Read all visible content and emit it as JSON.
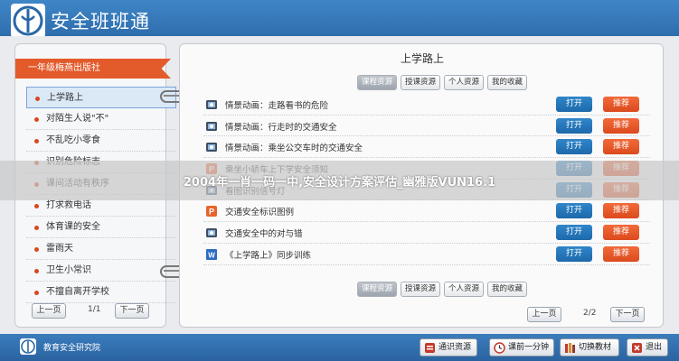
{
  "app": {
    "title": "安全班班通",
    "footer_org": "教育安全研究院"
  },
  "left_panel": {
    "grade_banner": "一年级梅燕出版社",
    "lessons": [
      {
        "label": "上学路上",
        "active": true
      },
      {
        "label": "对陌生人说\"不\"",
        "active": false
      },
      {
        "label": "不乱吃小零食",
        "active": false
      },
      {
        "label": "识别危险标志",
        "active": false
      },
      {
        "label": "课间活动有秩序",
        "active": false
      },
      {
        "label": "打求救电话",
        "active": false
      },
      {
        "label": "体育课的安全",
        "active": false
      },
      {
        "label": "雷雨天",
        "active": false
      },
      {
        "label": "卫生小常识",
        "active": false
      },
      {
        "label": "不擅自离开学校",
        "active": false
      }
    ],
    "pager": {
      "prev": "上一页",
      "info": "1/1",
      "next": "下一页"
    }
  },
  "right_panel": {
    "title": "上学路上",
    "tabs": [
      "课程资源",
      "授课资源",
      "个人资源",
      "我的收藏"
    ],
    "active_tab": 0,
    "open_label": "打开",
    "recommend_label": "推荐",
    "resources": [
      {
        "icon": "video-icon",
        "label": "情景动画：走路看书的危险"
      },
      {
        "icon": "video-icon",
        "label": "情景动画：行走时的交通安全"
      },
      {
        "icon": "video-icon",
        "label": "情景动画：乘坐公交车时的交通安全"
      },
      {
        "icon": "ppt-icon",
        "label": "乘坐小轿车上下学安全须知"
      },
      {
        "icon": "video-icon",
        "label": "看图识别信号灯"
      },
      {
        "icon": "ppt-icon",
        "label": "交通安全标识图例"
      },
      {
        "icon": "video-icon",
        "label": "交通安全中的对与错"
      },
      {
        "icon": "word-icon",
        "label": "《上学路上》同步训练"
      }
    ],
    "pager": {
      "prev": "上一页",
      "info": "2/2",
      "next": "下一页"
    }
  },
  "overlay_caption": "2004年一肖一码一中,安全设计方案评估_幽雅版VUN16.1",
  "footer_buttons": [
    {
      "icon": "resource-icon",
      "label": "通识资源"
    },
    {
      "icon": "clock-icon",
      "label": "课前一分钟"
    },
    {
      "icon": "books-icon",
      "label": "切换教材"
    },
    {
      "icon": "exit-icon",
      "label": "退出"
    }
  ],
  "colors": {
    "header_blue": "#2f6eae",
    "banner_orange": "#e35a2b",
    "open_blue": "#1d69ab",
    "recommend_orange": "#db4a1e"
  }
}
